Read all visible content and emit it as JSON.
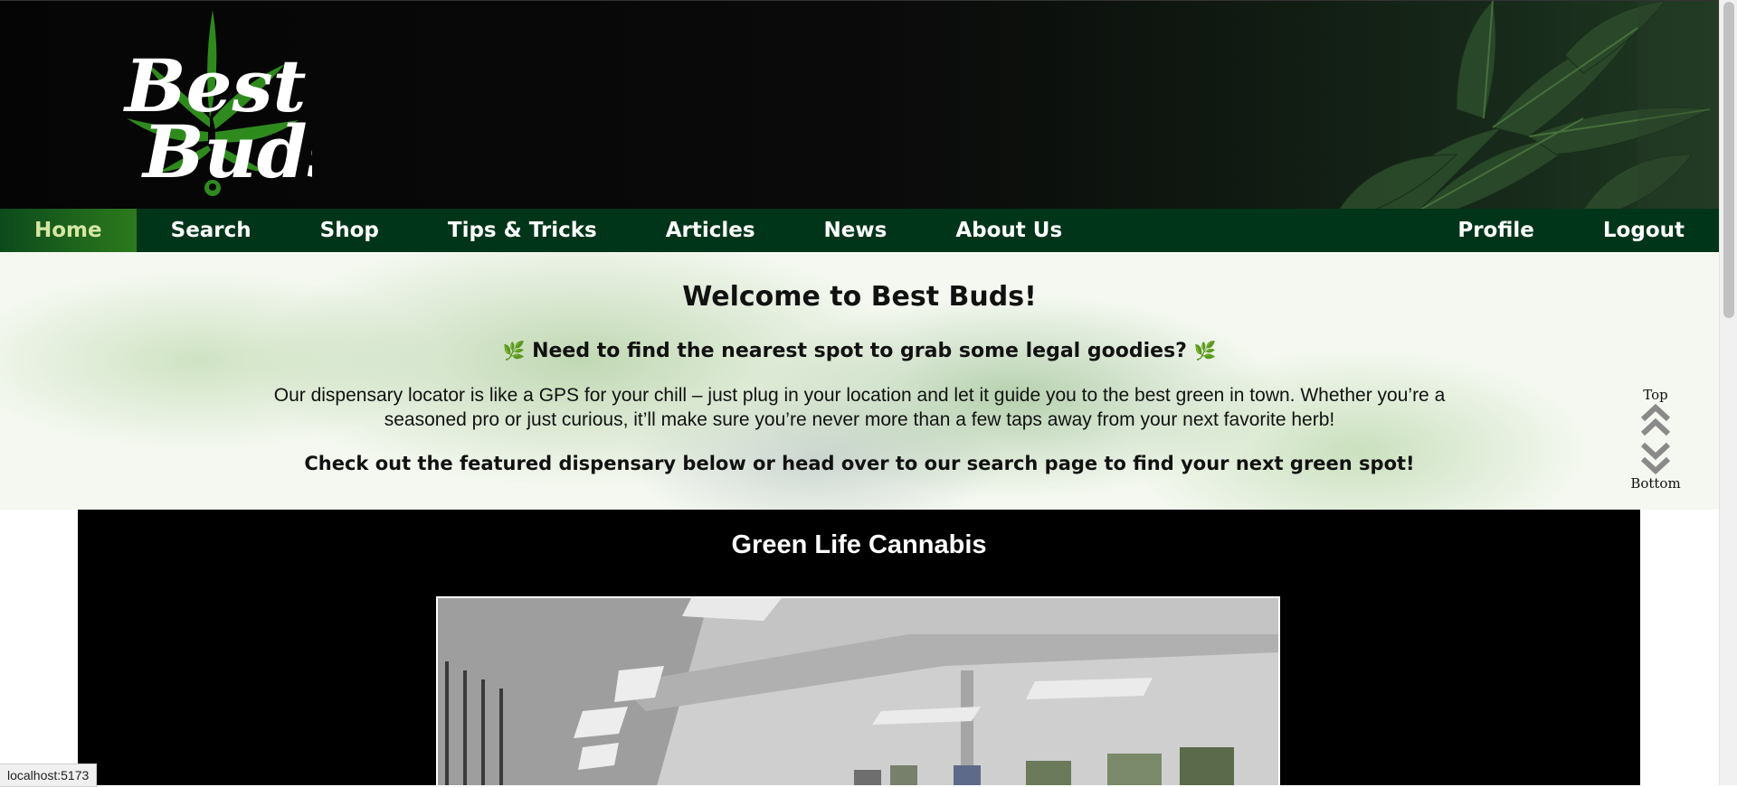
{
  "brand": {
    "logo_alt": "Best Buds",
    "leaf_color": "#2f8a1e",
    "text_color": "#ffffff"
  },
  "nav": {
    "items": [
      {
        "label": "Home",
        "active": true
      },
      {
        "label": "Search"
      },
      {
        "label": "Shop"
      },
      {
        "label": "Tips & Tricks"
      },
      {
        "label": "Articles"
      },
      {
        "label": "News"
      },
      {
        "label": "About Us"
      }
    ],
    "right": [
      {
        "label": "Profile"
      },
      {
        "label": "Logout"
      }
    ]
  },
  "hero": {
    "title": "Welcome to Best Buds!",
    "subtitle": "Need to find the nearest spot to grab some legal goodies?",
    "herb_icon": "🌿",
    "description": "Our dispensary locator is like a GPS for your chill – just plug in your location and let it guide you to the best green in town. Whether you’re a seasoned pro or just curious, it’ll make sure you’re never more than a few taps away from your next favorite herb!",
    "cta": "Check out the featured dispensary below or head over to our search page to find your next green spot!"
  },
  "featured": {
    "name": "Green Life Cannabis"
  },
  "scroll_widget": {
    "top_label": "Top",
    "bottom_label": "Bottom"
  },
  "status_bar": {
    "url": "localhost:5173"
  },
  "colors": {
    "nav_bg": "#01351a",
    "active_nav": "#2c7a1c",
    "header_bg": "#050505",
    "featured_bg": "#000000"
  }
}
